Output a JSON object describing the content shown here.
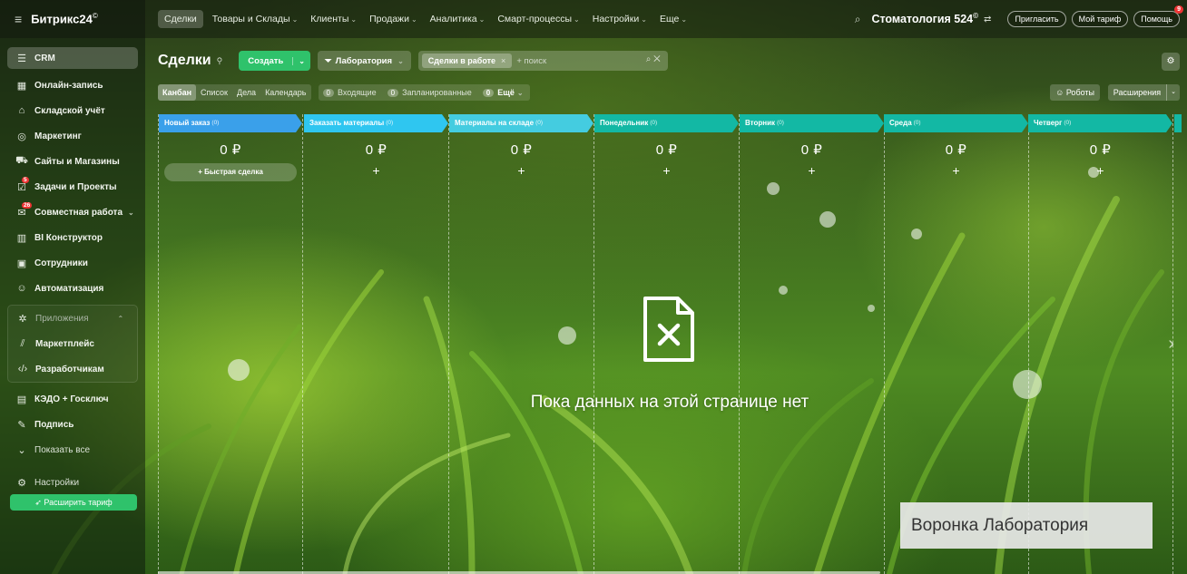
{
  "topbar": {
    "logo": "Битрикс24",
    "logo_mark": "©",
    "nav": [
      {
        "label": "Сделки",
        "active": true
      },
      {
        "label": "Товары и Склады"
      },
      {
        "label": "Клиенты"
      },
      {
        "label": "Продажи"
      },
      {
        "label": "Аналитика"
      },
      {
        "label": "Смарт-процессы"
      },
      {
        "label": "Настройки"
      },
      {
        "label": "Еще"
      }
    ],
    "company": "Стоматология 524",
    "company_mark": "©",
    "invite": "Пригласить",
    "tariff": "Мой тариф",
    "help": "Помощь",
    "help_badge": "9"
  },
  "sidebar": {
    "items": [
      {
        "label": "CRM",
        "icon": "filter-icon"
      },
      {
        "label": "Онлайн-запись",
        "icon": "calendar-icon"
      },
      {
        "label": "Складской учёт",
        "icon": "warehouse-icon"
      },
      {
        "label": "Маркетинг",
        "icon": "target-icon"
      },
      {
        "label": "Сайты и Магазины",
        "icon": "cart-icon"
      },
      {
        "label": "Задачи и Проекты",
        "icon": "checkbox-icon",
        "badge": "5"
      },
      {
        "label": "Совместная работа",
        "icon": "chat-icon",
        "badge": "26"
      },
      {
        "label": "BI Конструктор",
        "icon": "bar-chart-icon"
      },
      {
        "label": "Сотрудники",
        "icon": "id-card-icon"
      },
      {
        "label": "Автоматизация",
        "icon": "robot-icon"
      }
    ],
    "group": {
      "head": "Приложения",
      "items": [
        {
          "label": "Маркетплейс",
          "icon": "marketplace-icon"
        },
        {
          "label": "Разработчикам",
          "icon": "code-icon"
        }
      ]
    },
    "after": [
      {
        "label": "КЭДО + Госключ",
        "icon": "document-icon"
      },
      {
        "label": "Подпись",
        "icon": "signature-icon"
      },
      {
        "label": "Показать все",
        "icon": "chevron-down-icon"
      },
      {
        "label": "Настройки",
        "icon": "gear-icon"
      }
    ],
    "upgrade": "Расширить тариф"
  },
  "toolbar": {
    "title": "Сделки",
    "create": "Создать",
    "funnel": "Лаборатория",
    "filter_chip": "Сделки в работе",
    "search_placeholder": "+ поиск"
  },
  "subbar": {
    "views": [
      {
        "label": "Канбан",
        "active": true
      },
      {
        "label": "Список"
      },
      {
        "label": "Дела"
      },
      {
        "label": "Календарь"
      }
    ],
    "counters": [
      {
        "n": "0",
        "label": "Входящие"
      },
      {
        "n": "0",
        "label": "Запланированные"
      },
      {
        "n": "0",
        "label": "Ещё"
      }
    ],
    "robots": "Роботы",
    "extensions": "Расширения"
  },
  "kanban": {
    "columns": [
      {
        "name": "Новый заказ",
        "count": "(0)",
        "sum": "0 ₽",
        "color": "#3aa0ea"
      },
      {
        "name": "Заказать материалы",
        "count": "(0)",
        "sum": "0 ₽",
        "color": "#2fc6f0"
      },
      {
        "name": "Материалы на складе",
        "count": "(0)",
        "sum": "0 ₽",
        "color": "#44cce0"
      },
      {
        "name": "Понедельник",
        "count": "(0)",
        "sum": "0 ₽",
        "color": "#13b8a4"
      },
      {
        "name": "Вторник",
        "count": "(0)",
        "sum": "0 ₽",
        "color": "#13b8a4"
      },
      {
        "name": "Среда",
        "count": "(0)",
        "sum": "0 ₽",
        "color": "#13b8a4"
      },
      {
        "name": "Четверг",
        "count": "(0)",
        "sum": "0 ₽",
        "color": "#13b8a4"
      }
    ],
    "quick_deal": "+ Быстрая сделка",
    "plus": "+"
  },
  "empty_state": {
    "text": "Пока данных на этой странице нет"
  },
  "overlay": {
    "funnel_label": "Воронка Лаборатория"
  }
}
